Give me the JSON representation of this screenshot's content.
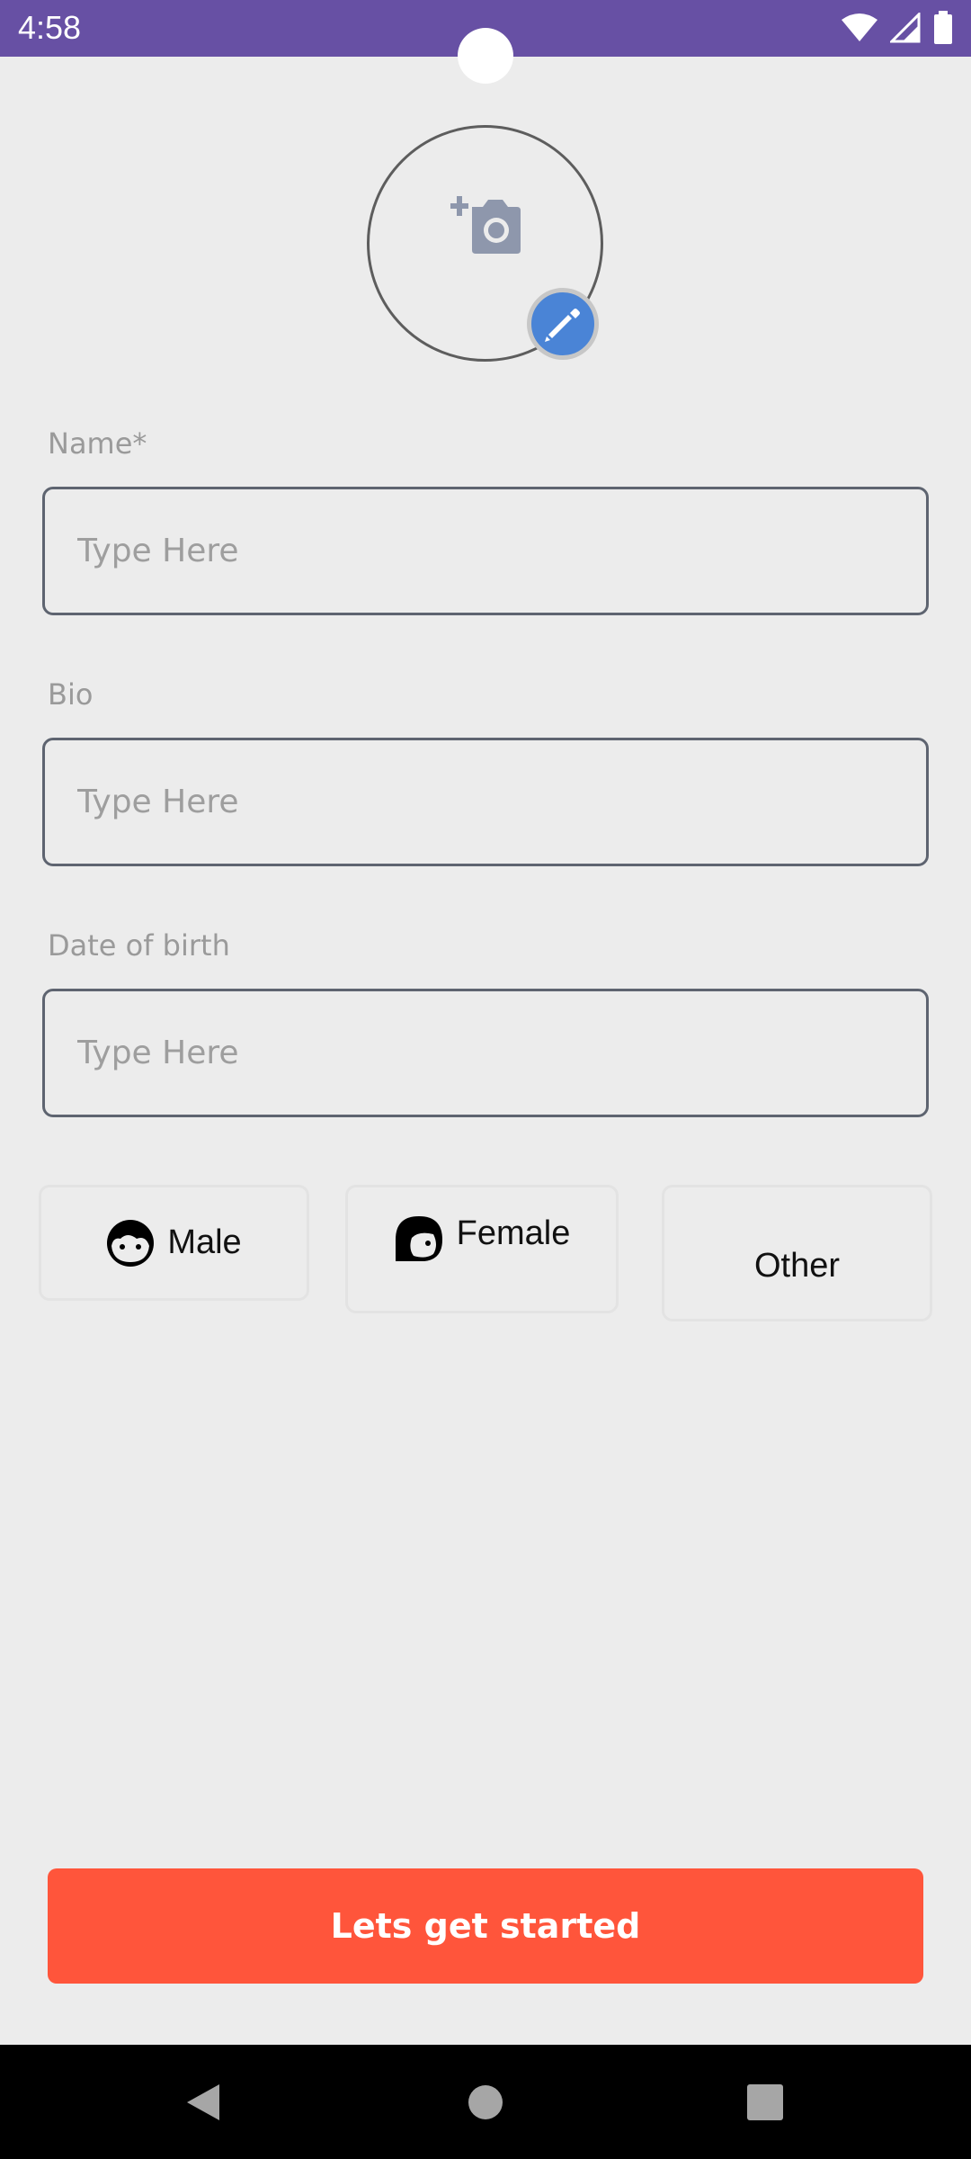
{
  "status_bar": {
    "time": "4:58",
    "icons": [
      "wifi-icon",
      "signal-icon",
      "battery-icon"
    ],
    "color": "#6750a4"
  },
  "avatar": {
    "icon": "add-photo-icon",
    "edit_icon": "pencil-icon",
    "edit_color": "#4a84d6"
  },
  "form": {
    "name": {
      "label": "Name*",
      "placeholder": "Type Here",
      "value": ""
    },
    "bio": {
      "label": "Bio",
      "placeholder": "Type Here",
      "value": ""
    },
    "dob": {
      "label": "Date of birth",
      "placeholder": "Type Here",
      "value": ""
    }
  },
  "gender": {
    "options": [
      {
        "label": "Male",
        "icon": "male-face-icon"
      },
      {
        "label": "Female",
        "icon": "female-face-icon"
      },
      {
        "label": "Other",
        "icon": ""
      }
    ]
  },
  "cta": {
    "label": "Lets get started",
    "color": "#ff553b"
  },
  "nav": {
    "icons": [
      "back-icon",
      "home-icon",
      "recents-icon"
    ]
  }
}
